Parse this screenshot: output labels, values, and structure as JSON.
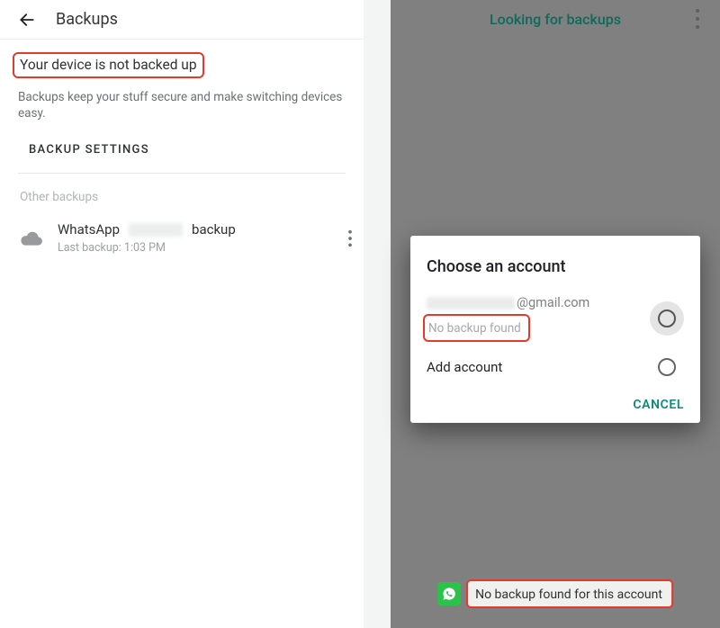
{
  "left": {
    "title": "Backups",
    "status_title": "Your device is not backed up",
    "status_desc": "Backups keep your stuff secure and make switching devices easy.",
    "backup_settings_label": "BACKUP SETTINGS",
    "other_backups_label": "Other backups",
    "item": {
      "name_prefix": "WhatsApp",
      "name_suffix": "backup",
      "last_backup_prefix": "Last backup: ",
      "last_backup_time": "1:03 PM"
    }
  },
  "right": {
    "header_title": "Looking for backups",
    "dialog": {
      "title": "Choose an account",
      "account_email_suffix": "@gmail.com",
      "no_backup_label": "No backup found",
      "add_account_label": "Add account",
      "cancel_label": "CANCEL"
    },
    "toast": "No backup found for this account"
  }
}
